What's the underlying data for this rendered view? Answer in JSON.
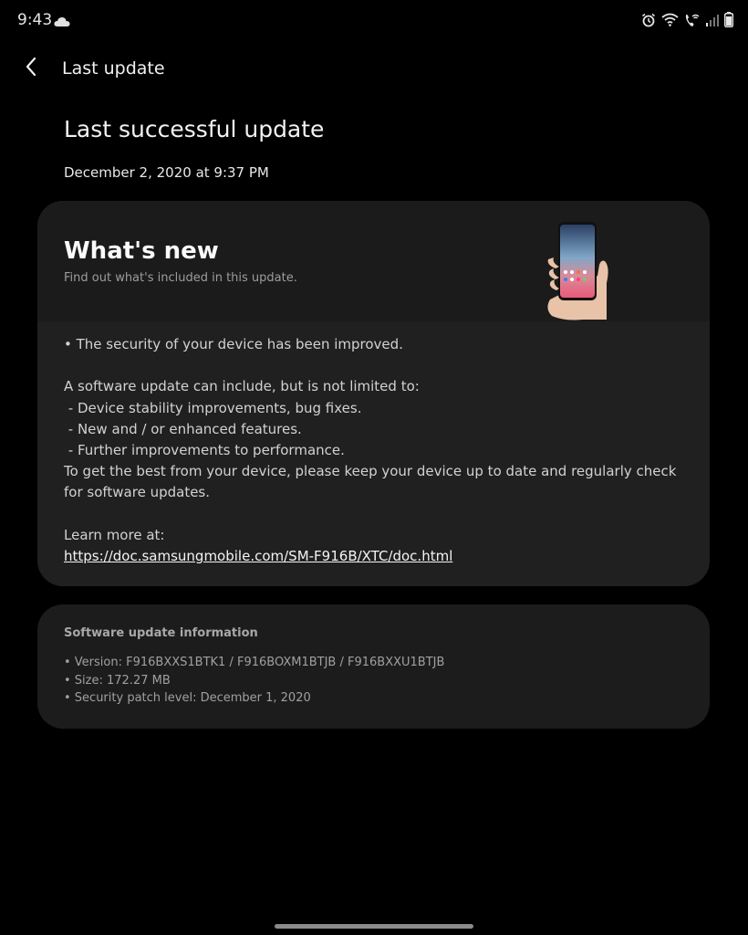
{
  "status_bar": {
    "time": "9:43",
    "icons": [
      "cloud-icon",
      "alarm-icon",
      "wifi-icon",
      "wifi-calling-icon",
      "signal-icon",
      "battery-icon"
    ]
  },
  "app_bar": {
    "back_icon": "chevron-left-icon",
    "title": "Last update"
  },
  "page": {
    "heading": "Last successful update",
    "date": "December 2, 2020 at 9:37 PM"
  },
  "whats_new": {
    "title": "What's new",
    "subtitle": "Find out what's included in this update.",
    "illustration": "phone-in-hand-illustration",
    "notes": [
      "• The security of your device has been improved.",
      "",
      "A software update can include, but is not limited to:",
      " - Device stability improvements, bug fixes.",
      " - New and / or enhanced features.",
      " - Further improvements to performance.",
      "To get the best from your device, please keep your device up to date and regularly check for software updates.",
      "",
      "Learn more at:"
    ],
    "link": "https://doc.samsungmobile.com/SM-F916B/XTC/doc.html"
  },
  "update_info": {
    "title": "Software update information",
    "items": [
      "• Version: F916BXXS1BTK1 / F916BOXM1BTJB / F916BXXU1BTJB",
      "• Size: 172.27 MB",
      "• Security patch level: December 1, 2020"
    ]
  },
  "colors": {
    "background": "#000000",
    "card": "#202020",
    "text": "#ffffff",
    "muted": "#a0a0a0"
  }
}
